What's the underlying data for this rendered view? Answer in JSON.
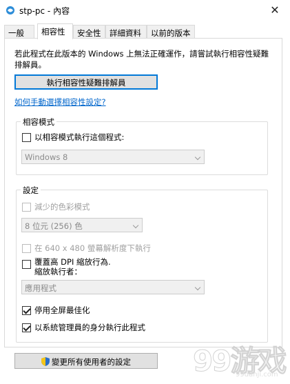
{
  "window": {
    "title": "stp-pc - 內容",
    "close_glyph": "✕"
  },
  "tabs": [
    {
      "label": "一般",
      "active": false
    },
    {
      "label": "相容性",
      "active": true
    },
    {
      "label": "安全性",
      "active": false
    },
    {
      "label": "詳細資料",
      "active": false
    },
    {
      "label": "以前的版本",
      "active": false
    }
  ],
  "compat": {
    "intro": "若此程式在此版本的 Windows 上無法正確運作，請嘗試執行相容性疑難排解員。",
    "troubleshooter_button": "執行相容性疑難排解員",
    "manual_link": "如何手動選擇相容性設定?"
  },
  "compat_mode": {
    "group_label": "相容模式",
    "checkbox_label": "以相容模式執行這個程式:",
    "checked": false,
    "os_select_value": "Windows 8"
  },
  "settings": {
    "group_label": "設定",
    "reduced_color": {
      "label": "減少的色彩模式",
      "checked": false,
      "disabled": true
    },
    "color_select_value": "8 位元 (256) 色",
    "resolution_640": {
      "label": "在 640 x 480 螢幕解析度下執行",
      "checked": false,
      "disabled": true
    },
    "high_dpi": {
      "label_line1": "覆蓋高 DPI 縮放行為.",
      "label_line2": "縮放執行者：",
      "checked": false
    },
    "dpi_select_value": "應用程式",
    "fullscreen_opt": {
      "label": "停用全屏最佳化",
      "checked": true
    },
    "run_as_admin": {
      "label": "以系統管理員的身分執行此程式",
      "checked": true
    }
  },
  "footer": {
    "change_all_users_button": "變更所有使用者的設定"
  },
  "watermark": {
    "logo_text": "99游戏",
    "domain_text": "99danji.com"
  },
  "colors": {
    "accent": "#0078d7",
    "link": "#0066cc",
    "disabled": "#a0a0a0"
  }
}
